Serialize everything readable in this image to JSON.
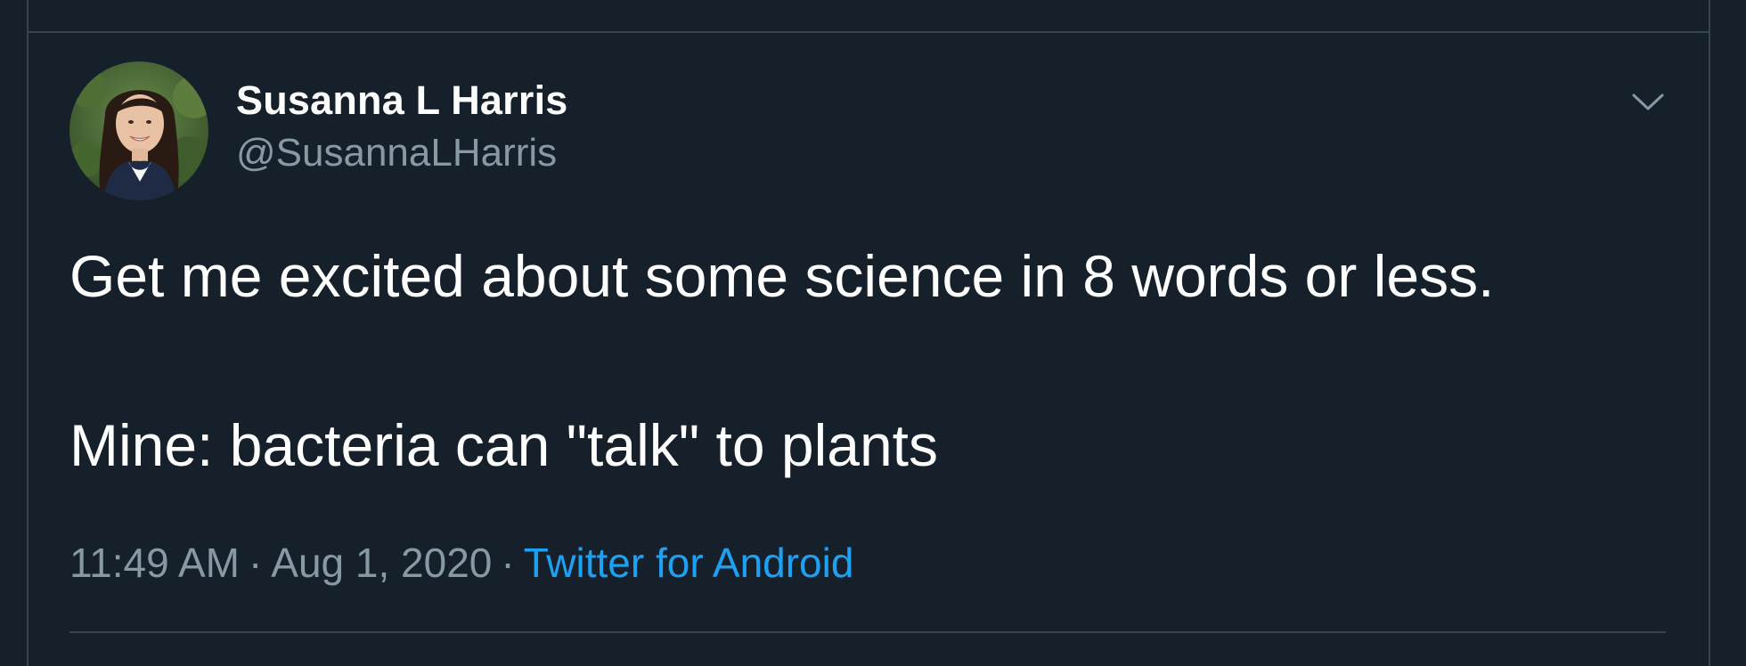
{
  "tweet": {
    "author": {
      "name": "Susanna L Harris",
      "handle": "@SusannaLHarris"
    },
    "text": {
      "line1": "Get me excited about some science in 8 words or less.",
      "line2": "Mine: bacteria can \"talk\" to plants"
    },
    "meta": {
      "time": "11:49 AM",
      "separator": "·",
      "date": "Aug 1, 2020",
      "source": "Twitter for Android"
    },
    "menu_icon": "chevron-down-icon"
  },
  "colors": {
    "background": "#15202b",
    "border": "#38444d",
    "primary_text": "#ffffff",
    "secondary_text": "#8899a6",
    "link": "#1da1f2"
  }
}
